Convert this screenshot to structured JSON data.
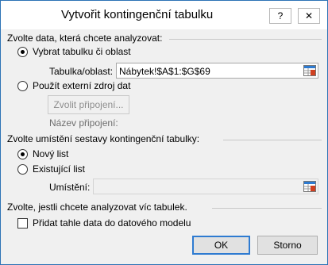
{
  "title": "Vytvořit kontingenční tabulku",
  "title_buttons": {
    "help": "?",
    "close": "✕"
  },
  "section1": {
    "heading": "Zvolte data, která chcete analyzovat:",
    "radio_select_table": "Vybrat tabulku či oblast",
    "table_range_label": "Tabulka/oblast:",
    "table_range_value": "Nábytek!$A$1:$G$69",
    "radio_external": "Použít externí zdroj dat",
    "choose_connection": "Zvolit připojení...",
    "connection_name_label": "Název připojení:"
  },
  "section2": {
    "heading": "Zvolte umístění sestavy kontingenční tabulky:",
    "radio_new_sheet": "Nový list",
    "radio_existing_sheet": "Existující list",
    "location_label": "Umístění:",
    "location_value": ""
  },
  "section3": {
    "heading": "Zvolte, jestli chcete analyzovat víc tabulek.",
    "checkbox_label": "Přidat tahle data do datového modelu"
  },
  "buttons": {
    "ok": "OK",
    "cancel": "Storno"
  },
  "state": {
    "select_table_selected": true,
    "new_sheet_selected": true,
    "data_model_checked": false
  },
  "colors": {
    "accent": "#2e7bd1",
    "border": "#2d73b5",
    "background": "#f0f0f0"
  }
}
